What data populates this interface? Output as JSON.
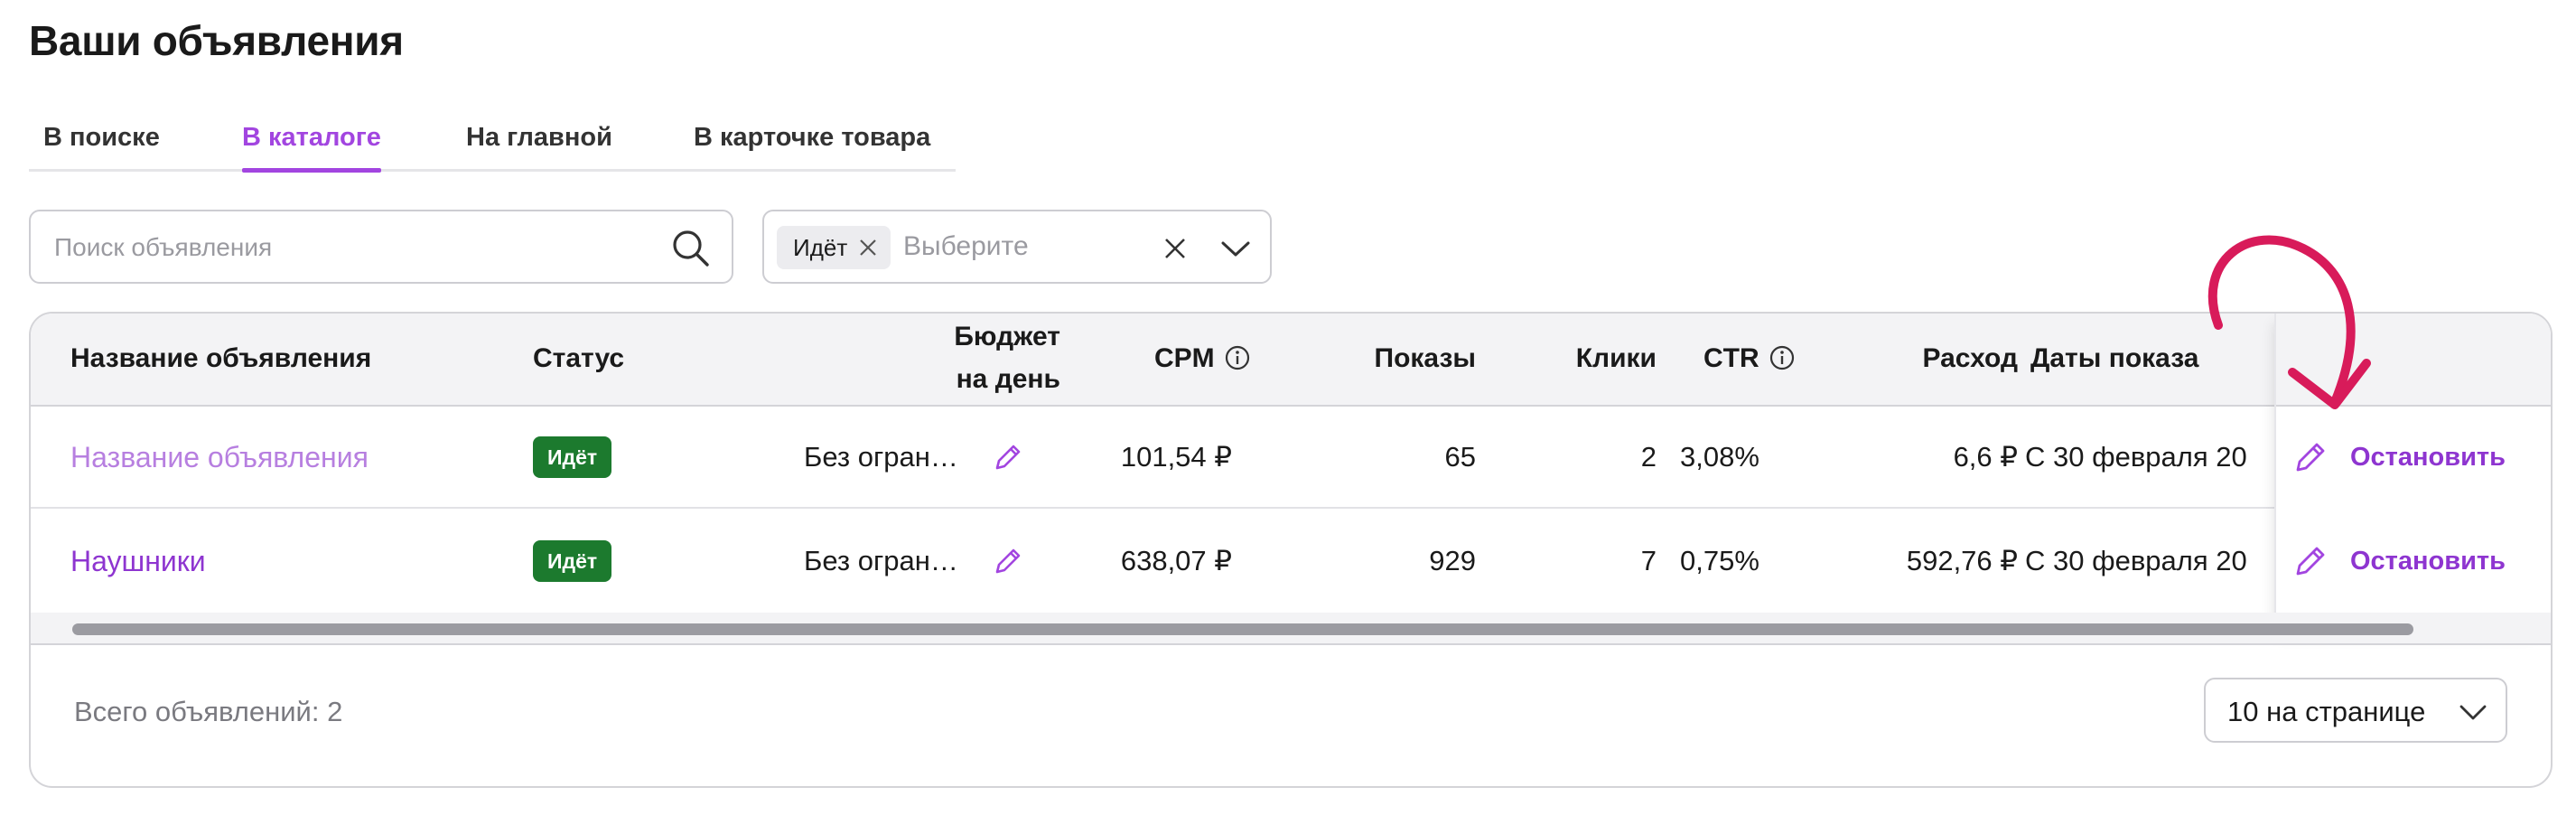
{
  "page": {
    "title": "Ваши объявления"
  },
  "tabs": [
    {
      "label": "В поиске",
      "active": false
    },
    {
      "label": "В каталоге",
      "active": true
    },
    {
      "label": "На главной",
      "active": false
    },
    {
      "label": "В карточке товара",
      "active": false
    }
  ],
  "search": {
    "placeholder": "Поиск объявления",
    "value": "",
    "icon": "search-icon"
  },
  "status_filter": {
    "chip_label": "Идёт",
    "placeholder": "Выберите",
    "clear_icon": "close-icon",
    "chevron_icon": "chevron-down-icon"
  },
  "table": {
    "headers": {
      "name": "Название объявления",
      "status": "Статус",
      "budget_line1": "Бюджет",
      "budget_line2": "на день",
      "cpm": "CPM",
      "impressions": "Показы",
      "clicks": "Клики",
      "ctr": "CTR",
      "spend": "Расход",
      "dates": "Даты показа"
    },
    "rows": [
      {
        "name": "Название объявления",
        "status": "Идёт",
        "budget": "Без огран…",
        "cpm": "101,54 ₽",
        "impressions": "65",
        "clicks": "2",
        "ctr": "3,08%",
        "spend": "6,6 ₽",
        "dates": "С 30 февраля 20",
        "action": "Остановить"
      },
      {
        "name": "Наушники",
        "status": "Идёт",
        "budget": "Без огран…",
        "cpm": "638,07 ₽",
        "impressions": "929",
        "clicks": "7",
        "ctr": "0,75%",
        "spend": "592,76 ₽",
        "dates": "С 30 февраля 20",
        "action": "Остановить"
      }
    ]
  },
  "footer": {
    "total": "Всего объявлений: 2",
    "page_size": "10 на странице"
  },
  "colors": {
    "accent": "#a245e0",
    "action": "#8e35d0",
    "status_green": "#1c7a2e",
    "annotation": "#d81b5a"
  }
}
